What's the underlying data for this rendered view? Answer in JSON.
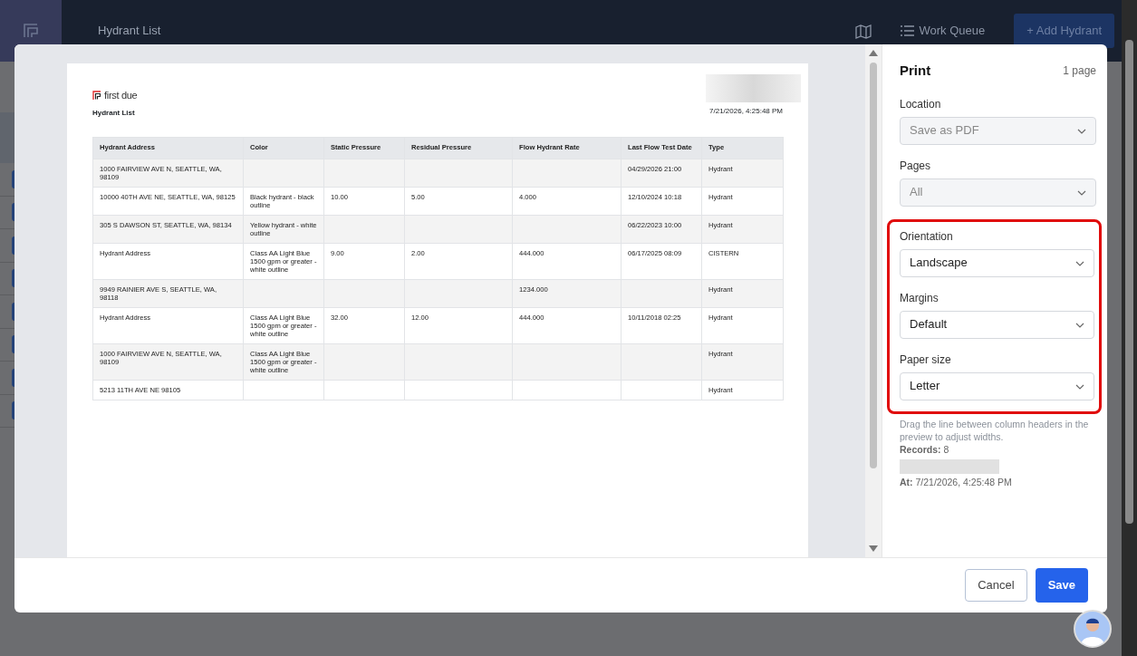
{
  "app_bar": {
    "title": "Hydrant List",
    "work_queue": "Work Queue",
    "add_button": "+ Add Hydrant"
  },
  "background_rows": [
    {
      "checked": true
    },
    {
      "checked": true
    },
    {
      "checked": true
    },
    {
      "checked": true
    },
    {
      "checked": true
    },
    {
      "checked": true
    },
    {
      "checked": true
    },
    {
      "checked": true
    }
  ],
  "preview": {
    "brand": "first due",
    "title": "Hydrant List",
    "printed_at": "7/21/2026, 4:25:48 PM",
    "table": {
      "columns": [
        "Hydrant Address",
        "Color",
        "Static Pressure",
        "Residual Pressure",
        "Flow Hydrant Rate",
        "Last Flow Test Date",
        "Type"
      ],
      "rows": [
        [
          "1000 FAIRVIEW AVE N, SEATTLE, WA, 98109",
          "",
          "",
          "",
          "",
          "04/29/2026 21:00",
          "Hydrant"
        ],
        [
          "10000 40TH AVE NE, SEATTLE, WA, 98125",
          "Black hydrant - black outline",
          "10.00",
          "5.00",
          "4.000",
          "12/10/2024 10:18",
          "Hydrant"
        ],
        [
          "305 S DAWSON ST, SEATTLE, WA, 98134",
          "Yellow hydrant - white outline",
          "",
          "",
          "",
          "06/22/2023 10:00",
          "Hydrant"
        ],
        [
          "Hydrant Address",
          "Class AA Light Blue 1500 gpm or greater - white outline",
          "9.00",
          "2.00",
          "444.000",
          "06/17/2025 08:09",
          "CISTERN"
        ],
        [
          "9949 RAINIER AVE S, SEATTLE, WA, 98118",
          "",
          "",
          "",
          "1234.000",
          "",
          "Hydrant"
        ],
        [
          "Hydrant Address",
          "Class AA Light Blue 1500 gpm or greater - white outline",
          "32.00",
          "12.00",
          "444.000",
          "10/11/2018 02:25",
          "Hydrant"
        ],
        [
          "1000 FAIRVIEW AVE N, SEATTLE, WA, 98109",
          "Class AA Light Blue 1500 gpm or greater - white outline",
          "",
          "",
          "",
          "",
          "Hydrant"
        ],
        [
          "5213 11TH AVE NE 98105",
          "",
          "",
          "",
          "",
          "",
          "Hydrant"
        ]
      ]
    }
  },
  "print_panel": {
    "title": "Print",
    "page_count": "1 page",
    "settings": [
      {
        "label": "Location",
        "value": "Save as PDF",
        "disabled": true,
        "highlighted": false
      },
      {
        "label": "Pages",
        "value": "All",
        "disabled": true,
        "highlighted": false
      },
      {
        "label": "Orientation",
        "value": "Landscape",
        "disabled": false,
        "highlighted": true
      },
      {
        "label": "Margins",
        "value": "Default",
        "disabled": false,
        "highlighted": true
      },
      {
        "label": "Paper size",
        "value": "Letter",
        "disabled": false,
        "highlighted": true
      }
    ],
    "hint": "Drag the line between column headers in the preview to adjust widths.",
    "records_label": "Records:",
    "records_value": "8",
    "at_label": "At:",
    "at_value": "7/21/2026, 4:25:48 PM"
  },
  "buttons": [
    {
      "label": "Cancel",
      "kind": "secondary"
    },
    {
      "label": "Save",
      "kind": "primary"
    }
  ]
}
